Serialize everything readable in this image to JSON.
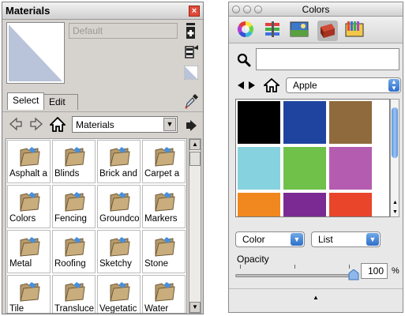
{
  "materials": {
    "title": "Materials",
    "close_glyph": "×",
    "material_name": "Default",
    "tabs": [
      {
        "label": "Select"
      },
      {
        "label": "Edit"
      }
    ],
    "collection": "Materials",
    "select_arrow": "▼",
    "detail_glyph": "▶",
    "items": [
      {
        "label": "Asphalt a"
      },
      {
        "label": "Blinds"
      },
      {
        "label": "Brick and"
      },
      {
        "label": "Carpet a"
      },
      {
        "label": "Colors"
      },
      {
        "label": "Fencing"
      },
      {
        "label": "Groundco"
      },
      {
        "label": "Markers"
      },
      {
        "label": "Metal"
      },
      {
        "label": "Roofing"
      },
      {
        "label": "Sketchy"
      },
      {
        "label": "Stone"
      },
      {
        "label": "Tile"
      },
      {
        "label": "Transluce"
      },
      {
        "label": "Vegetatic"
      },
      {
        "label": "Water"
      }
    ],
    "scroll_up": "▲",
    "scroll_down": "▼",
    "icons": {
      "close": "close-icon",
      "create": "create-material-icon",
      "sample": "paint-bucket-icon",
      "default": "default-material-icon",
      "eyedropper": "eyedropper-icon",
      "back": "back-arrow-icon",
      "forward": "forward-arrow-icon",
      "home": "home-icon",
      "folder": "folder-icon"
    },
    "colors": {
      "preview_fill": "#b9c3d9",
      "folder": "#b79a6a"
    }
  },
  "colors_panel": {
    "title": "Colors",
    "palette": "Apple",
    "popup_arrow": "▲▼",
    "swatches": [
      {
        "color": "#000000"
      },
      {
        "color": "#1f44a0"
      },
      {
        "color": "#8e6a3c"
      },
      {
        "color": "#86d2df"
      },
      {
        "color": "#6fc149"
      },
      {
        "color": "#b45cb0"
      },
      {
        "color": "#f0881f"
      },
      {
        "color": "#7a2a92"
      },
      {
        "color": "#e8452a"
      }
    ],
    "mode_select": "Color",
    "view_select": "List",
    "select_arrow": "▼",
    "opacity_label": "Opacity",
    "opacity_value": "100",
    "opacity_unit": "%",
    "expand_glyph": "▲",
    "icons": {
      "color_wheel": "color-wheel-icon",
      "sliders": "color-sliders-icon",
      "image_palettes": "image-palettes-icon",
      "palettes": "color-palettes-icon",
      "pencils": "crayons-icon",
      "search": "magnifier-icon",
      "back": "back-triangle-icon",
      "forward": "forward-triangle-icon",
      "home": "home-icon"
    }
  }
}
